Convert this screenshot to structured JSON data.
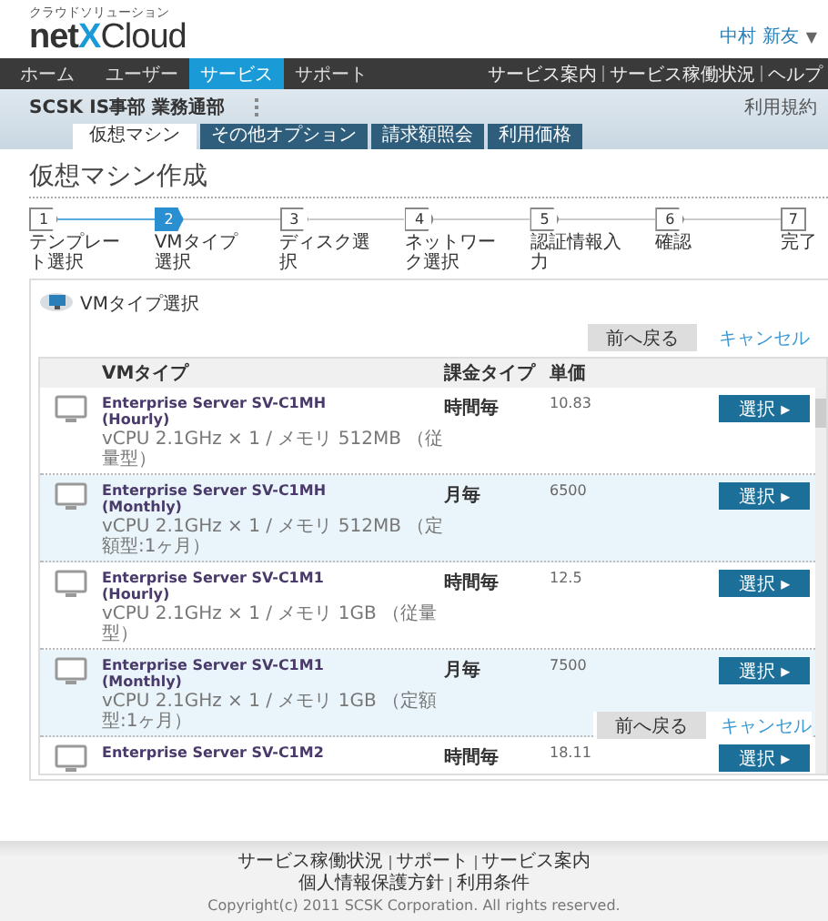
{
  "header": {
    "tagline": "クラウドソリューション",
    "logo_prefix": "net",
    "logo_x": "X",
    "logo_suffix": "Cloud",
    "user": "中村 新友",
    "user_menu": "▼"
  },
  "nav": {
    "items": [
      {
        "label": "ホーム",
        "selected": false
      },
      {
        "label": "ユーザー",
        "selected": false
      },
      {
        "label": "サービス",
        "selected": true
      },
      {
        "label": "サポート",
        "selected": false
      }
    ],
    "links": [
      "サービス案内",
      "サービス稼働状況",
      "ヘルプ"
    ],
    "sub_link": "利用規約"
  },
  "org": "SCSK IS事部 業務通部",
  "subtabs": [
    {
      "label": "仮想マシン",
      "selected": true
    },
    {
      "label": "その他オプション",
      "selected": false
    },
    {
      "label": "請求額照会",
      "selected": false
    },
    {
      "label": "利用価格",
      "selected": false
    }
  ],
  "page_title": "仮想マシン作成",
  "steps": [
    {
      "number": "1",
      "label": "テンプレート選択",
      "selected": false
    },
    {
      "number": "2",
      "label": "VMタイプ選択",
      "selected": true
    },
    {
      "number": "3",
      "label": "ディスク選択",
      "selected": false
    },
    {
      "number": "4",
      "label": "ネットワーク選択",
      "selected": false
    },
    {
      "number": "5",
      "label": "認証情報入力",
      "selected": false
    },
    {
      "number": "6",
      "label": "確認",
      "selected": false
    },
    {
      "number": "7",
      "label": "完了",
      "selected": false
    }
  ],
  "panel": {
    "title": "VMタイプ選択",
    "back_button": "前へ戻る",
    "cancel_link": "キャンセル",
    "table": {
      "columns": [
        "VMタイプ",
        "課金タイプ",
        "単価"
      ],
      "rows": [
        {
          "name": "Enterprise Server SV-C1MH",
          "plan": "(Hourly)",
          "spec": "vCPU 2.1GHz × 1 / メモリ 512MB （従量型）",
          "billing": "時間毎",
          "price": "10.83",
          "action": "選択 ▸"
        },
        {
          "name": "Enterprise Server SV-C1MH",
          "plan": "(Monthly)",
          "spec": "vCPU 2.1GHz × 1 / メモリ 512MB （定額型:1ヶ月）",
          "billing": "月毎",
          "price": "6500",
          "action": "選択 ▸"
        },
        {
          "name": "Enterprise Server SV-C1M1",
          "plan": "(Hourly)",
          "spec": "vCPU 2.1GHz × 1 / メモリ 1GB （従量型）",
          "billing": "時間毎",
          "price": "12.5",
          "action": "選択 ▸"
        },
        {
          "name": "Enterprise Server SV-C1M1",
          "plan": "(Monthly)",
          "spec": "vCPU 2.1GHz × 1 / メモリ 1GB （定額型:1ヶ月）",
          "billing": "月毎",
          "price": "7500",
          "action": "選択 ▸"
        },
        {
          "name": "Enterprise Server SV-C1M2",
          "billing": "時間毎",
          "price": "18.11",
          "action": "選択 ▸"
        }
      ]
    },
    "bottom_back_button": "前へ戻る",
    "bottom_cancel_link": "キャンセル"
  },
  "footer": {
    "links_1": [
      "サービス稼働状況",
      "サポート",
      "サービス案内"
    ],
    "links_2": [
      "個人情報保護方針",
      "利用条件"
    ],
    "copyright": "Copyright(c) 2011 SCSK Corporation. All rights reserved."
  }
}
